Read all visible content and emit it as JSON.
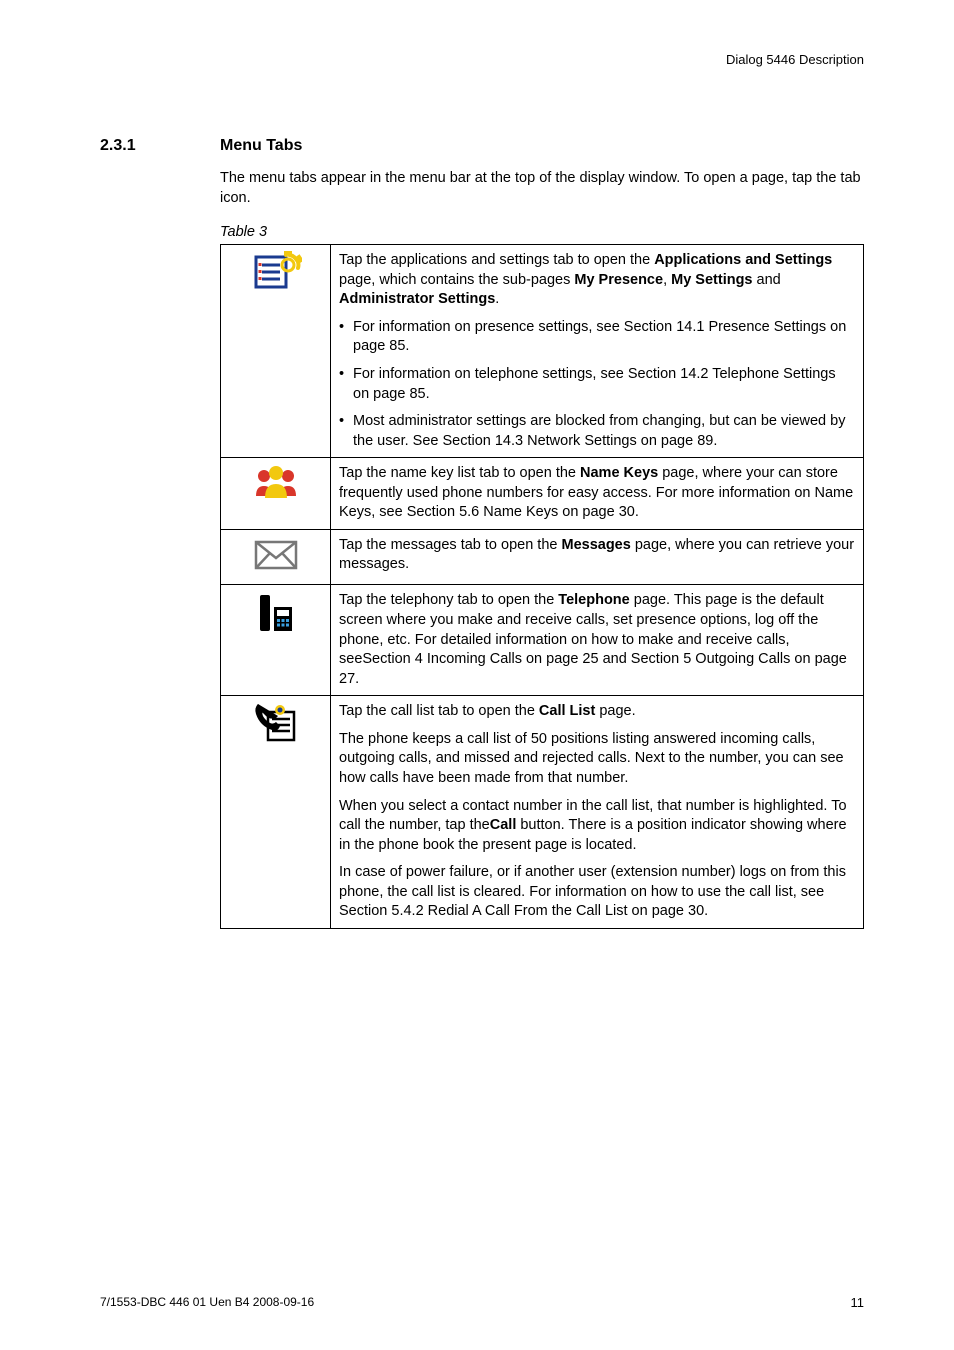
{
  "header": {
    "doc_title": "Dialog 5446 Description"
  },
  "section": {
    "number": "2.3.1",
    "title": "Menu Tabs"
  },
  "intro": "The menu tabs appear in the menu bar at the top of the display window. To open a page, tap the tab icon.",
  "table_caption": "Table 3",
  "rows": {
    "r1": {
      "p1_a": "Tap the applications and settings tab to open the ",
      "p1_b": "Applications and Settings",
      "p1_c": " page, which contains the sub-pages ",
      "p1_d": "My Presence",
      "p1_e": ", ",
      "p1_f": "My Settings",
      "p1_g": " and ",
      "p1_h": "Administrator Settings",
      "p1_i": ".",
      "b1": "For information on presence settings, see Section 14.1 Presence Settings on page 85.",
      "b2": "For information on telephone settings, see Section 14.2 Telephone Settings on page 85.",
      "b3": "Most administrator settings are blocked from changing, but can be viewed by the user. See Section 14.3 Network Settings on page 89."
    },
    "r2": {
      "a": "Tap the name key list tab to open the ",
      "b": "Name Keys",
      "c": " page, where your can store frequently used phone numbers for easy access. For more information on Name Keys, see Section 5.6 Name Keys on page 30."
    },
    "r3": {
      "a": "Tap the messages tab to open the ",
      "b": "Messages",
      "c": " page, where you can retrieve your messages."
    },
    "r4": {
      "a": "Tap the telephony tab to open the ",
      "b": "Telephone",
      "c": " page. This page is the default screen where you make and receive calls, set presence options, log off the phone, etc. For detailed information on how to make and receive calls, seeSection 4 Incoming Calls on page 25 and Section 5 Outgoing Calls on page 27."
    },
    "r5": {
      "p1_a": "Tap the call list tab to open the ",
      "p1_b": "Call List",
      "p1_c": " page.",
      "p2": "The phone keeps a call list of 50 positions listing answered incoming calls, outgoing calls, and missed and rejected calls. Next to the number, you can see how calls have been made from that number.",
      "p3_a": "When you select a contact number in the call list, that number is highlighted. To call the number, tap the",
      "p3_b": "Call",
      "p3_c": " button. There is a position indicator showing where in the phone book the present page is located.",
      "p4": "In case of power failure, or if another user (extension number) logs on from this phone, the call list is cleared. For information on how to use the call list, see Section 5.4.2 Redial A Call From the Call List on page 30."
    }
  },
  "footer": {
    "left": "7/1553-DBC 446 01 Uen B4  2008-09-16",
    "right": "11"
  },
  "bullet_symbol": "•"
}
